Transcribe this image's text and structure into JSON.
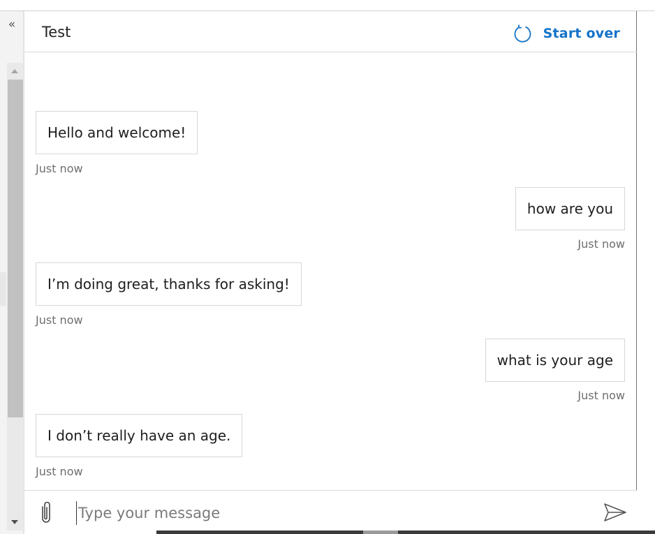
{
  "sidebar": {
    "collapse_glyph": "«",
    "collapse_icon": "double-chevron-left-icon"
  },
  "header": {
    "title": "Test",
    "start_over_label": "Start over",
    "start_over_icon": "refresh-icon",
    "accent_color": "#1473c8"
  },
  "messages": [
    {
      "from": "bot",
      "text": "Hello and welcome!",
      "time": "Just now"
    },
    {
      "from": "user",
      "text": "how are you",
      "time": "Just now"
    },
    {
      "from": "bot",
      "text": "I’m doing great, thanks for asking!",
      "time": "Just now"
    },
    {
      "from": "user",
      "text": "what is your age",
      "time": "Just now"
    },
    {
      "from": "bot",
      "text": "I don’t really have an age.",
      "time": "Just now"
    }
  ],
  "composer": {
    "placeholder": "Type your message",
    "value": "",
    "attach_icon": "paperclip-icon",
    "send_icon": "send-icon"
  }
}
